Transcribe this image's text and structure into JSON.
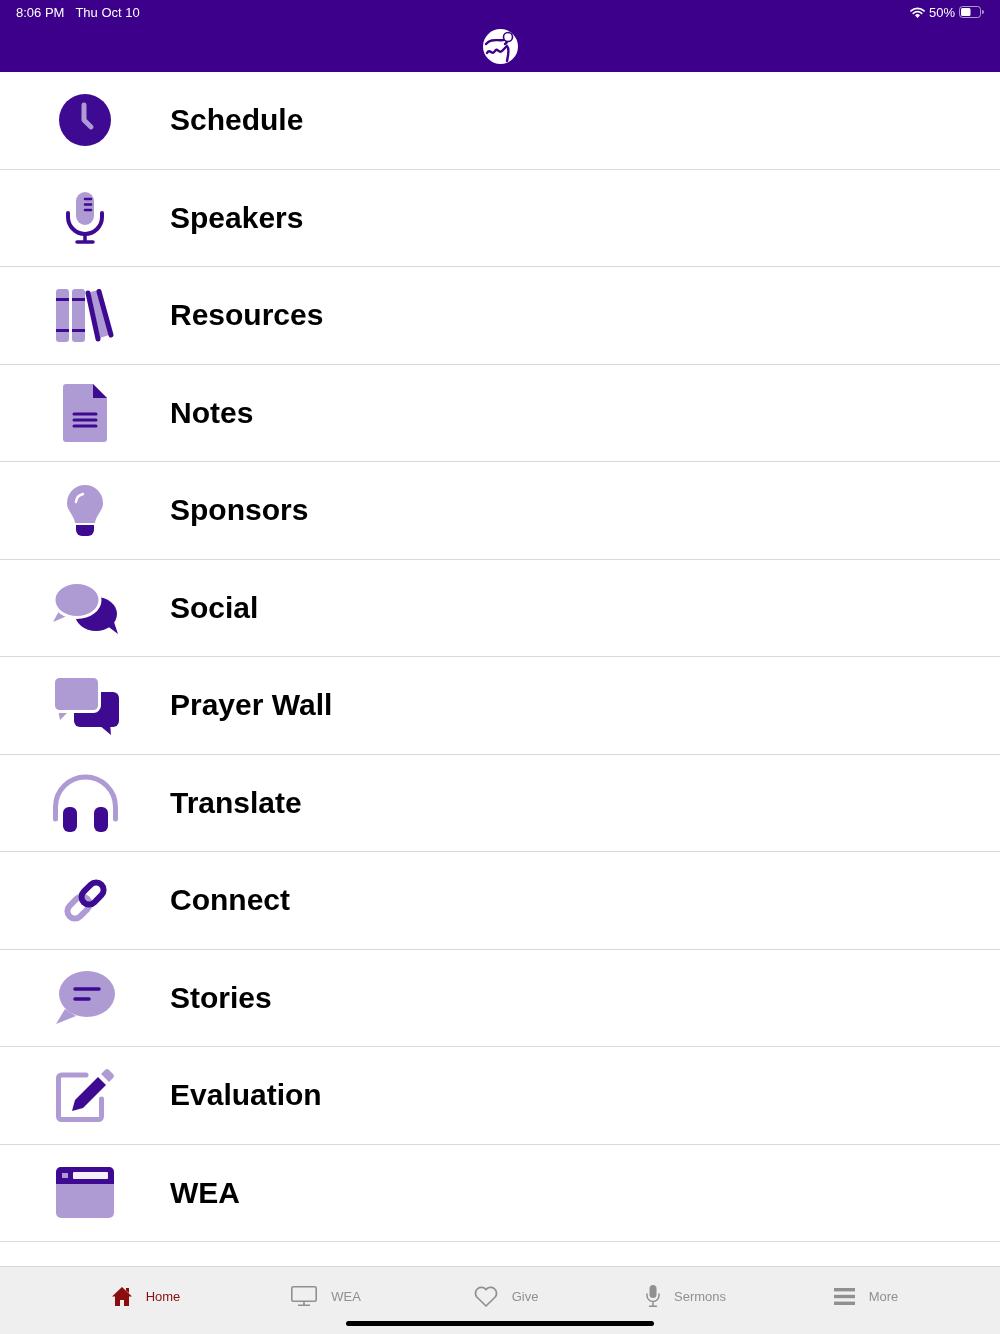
{
  "status_bar": {
    "time": "8:06 PM",
    "date": "Thu Oct 10",
    "battery": "50%"
  },
  "menu": [
    {
      "label": "Schedule"
    },
    {
      "label": "Speakers"
    },
    {
      "label": "Resources"
    },
    {
      "label": "Notes"
    },
    {
      "label": "Sponsors"
    },
    {
      "label": "Social"
    },
    {
      "label": "Prayer Wall"
    },
    {
      "label": "Translate"
    },
    {
      "label": "Connect"
    },
    {
      "label": "Stories"
    },
    {
      "label": "Evaluation"
    },
    {
      "label": "WEA"
    }
  ],
  "tab_bar": [
    {
      "label": "Home",
      "selected": true
    },
    {
      "label": "WEA",
      "selected": false
    },
    {
      "label": "Give",
      "selected": false
    },
    {
      "label": "Sermons",
      "selected": false
    },
    {
      "label": "More",
      "selected": false
    }
  ]
}
